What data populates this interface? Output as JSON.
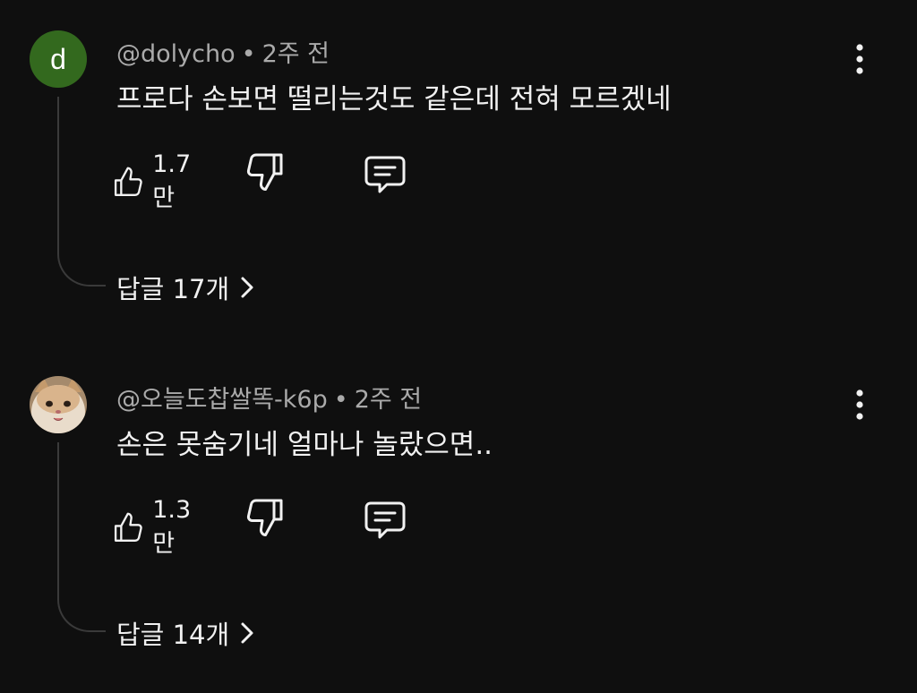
{
  "colors": {
    "background": "#0f0f0f",
    "primary_text": "#f1f1f1",
    "secondary_text": "#aaaaaa",
    "thread_line": "#3a3a3a",
    "avatar_letter_bg": "#33691e"
  },
  "comments": [
    {
      "avatar": {
        "type": "letter",
        "letter": "d"
      },
      "author": "@dolycho",
      "separator": "•",
      "time": "2주 전",
      "text": "프로다 손보면 떨리는것도 같은데 전혀 모르겠네",
      "likes": "1.7만",
      "replies_label": "답글 17개",
      "icons": {
        "like": "thumbs-up-icon",
        "dislike": "thumbs-down-icon",
        "reply": "comment-icon",
        "more": "more-vertical-icon",
        "expand": "chevron-right-icon"
      }
    },
    {
      "avatar": {
        "type": "photo",
        "description_icon": "cat-avatar-icon"
      },
      "author": "@오늘도찹쌀똑-k6p",
      "separator": "•",
      "time": "2주 전",
      "text": "손은 못숨기네 얼마나 놀랐으면..",
      "likes": "1.3만",
      "replies_label": "답글 14개",
      "icons": {
        "like": "thumbs-up-icon",
        "dislike": "thumbs-down-icon",
        "reply": "comment-icon",
        "more": "more-vertical-icon",
        "expand": "chevron-right-icon"
      }
    }
  ]
}
